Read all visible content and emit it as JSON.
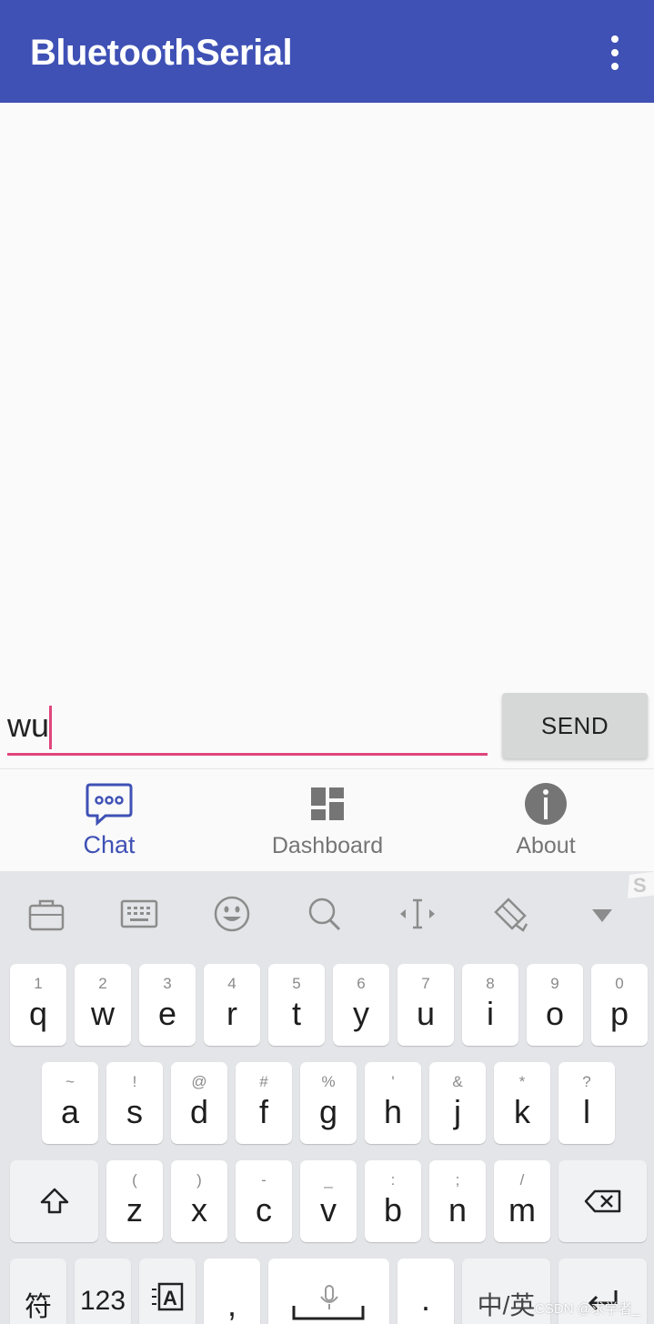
{
  "app": {
    "title": "BluetoothSerial"
  },
  "chat": {
    "input_value": "wu",
    "send_label": "SEND"
  },
  "bottom_nav": {
    "items": [
      {
        "label": "Chat",
        "icon": "chat-bubble-icon",
        "active": true
      },
      {
        "label": "Dashboard",
        "icon": "dashboard-icon",
        "active": false
      },
      {
        "label": "About",
        "icon": "info-icon",
        "active": false
      }
    ]
  },
  "keyboard": {
    "toolbar_icons": [
      "toolbox-icon",
      "keyboard-icon",
      "emoji-icon",
      "search-icon",
      "cursor-move-icon",
      "clipboard-icon",
      "collapse-icon"
    ],
    "row1": [
      {
        "sub": "1",
        "main": "q"
      },
      {
        "sub": "2",
        "main": "w"
      },
      {
        "sub": "3",
        "main": "e"
      },
      {
        "sub": "4",
        "main": "r"
      },
      {
        "sub": "5",
        "main": "t"
      },
      {
        "sub": "6",
        "main": "y"
      },
      {
        "sub": "7",
        "main": "u"
      },
      {
        "sub": "8",
        "main": "i"
      },
      {
        "sub": "9",
        "main": "o"
      },
      {
        "sub": "0",
        "main": "p"
      }
    ],
    "row2": [
      {
        "sub": "~",
        "main": "a"
      },
      {
        "sub": "!",
        "main": "s"
      },
      {
        "sub": "@",
        "main": "d"
      },
      {
        "sub": "#",
        "main": "f"
      },
      {
        "sub": "%",
        "main": "g"
      },
      {
        "sub": "'",
        "main": "h"
      },
      {
        "sub": "&",
        "main": "j"
      },
      {
        "sub": "*",
        "main": "k"
      },
      {
        "sub": "?",
        "main": "l"
      }
    ],
    "row3": [
      {
        "sub": "(",
        "main": "z"
      },
      {
        "sub": ")",
        "main": "x"
      },
      {
        "sub": "-",
        "main": "c"
      },
      {
        "sub": "_",
        "main": "v"
      },
      {
        "sub": ":",
        "main": "b"
      },
      {
        "sub": ";",
        "main": "n"
      },
      {
        "sub": "/",
        "main": "m"
      }
    ],
    "row4": {
      "symbols": "符",
      "numbers": "123",
      "comma": ",",
      "period": ".",
      "lang": "中/英"
    }
  },
  "watermark": "CSDN @求学者_",
  "colors": {
    "primary": "#3f51b5",
    "accent": "#e0457b"
  }
}
